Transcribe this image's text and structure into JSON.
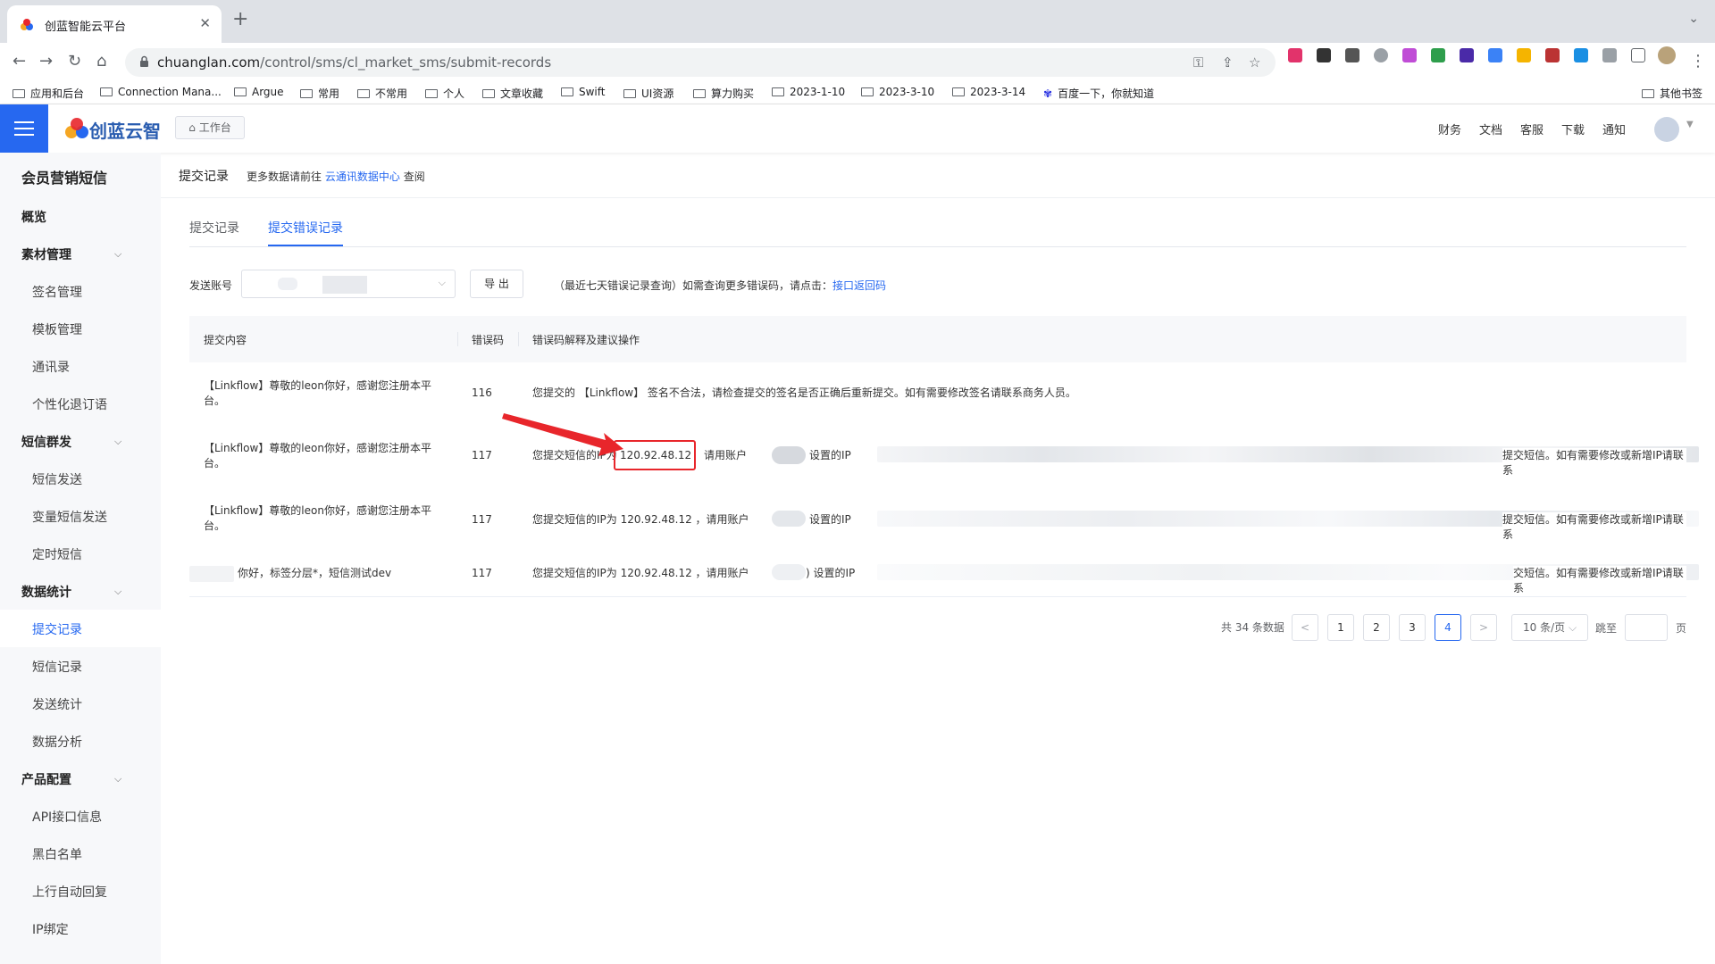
{
  "browser": {
    "tab_title": "创蓝智能云平台",
    "tab_close": "✕",
    "new_tab": "+",
    "tab_menu": "⌄",
    "url_host": "chuanglan.com",
    "url_path": "/control/sms/cl_market_sms/submit-records",
    "bookmarks": [
      "应用和后台",
      "Connection Mana...",
      "Argue",
      "常用",
      "不常用",
      "个人",
      "文章收藏",
      "Swift",
      "UI资源",
      "算力购买",
      "2023-1-10",
      "2023-3-10",
      "2023-3-14",
      "百度一下，你就知道"
    ],
    "other_bookmarks": "其他书签"
  },
  "header": {
    "logo_text": "创蓝云智",
    "workbench": "工作台",
    "nav": [
      "财务",
      "文档",
      "客服",
      "下载",
      "通知"
    ]
  },
  "sidebar": {
    "title": "会员营销短信",
    "overview": "概览",
    "groups": [
      {
        "label": "素材管理",
        "items": [
          "签名管理",
          "模板管理",
          "通讯录",
          "个性化退订语"
        ]
      },
      {
        "label": "短信群发",
        "items": [
          "短信发送",
          "变量短信发送",
          "定时短信"
        ]
      },
      {
        "label": "数据统计",
        "items": [
          "提交记录",
          "短信记录",
          "发送统计",
          "数据分析"
        ]
      },
      {
        "label": "产品配置",
        "items": [
          "API接口信息",
          "黑白名单",
          "上行自动回复",
          "IP绑定"
        ]
      }
    ],
    "active_item": "提交记录"
  },
  "main": {
    "crumb_title": "提交记录",
    "crumb_prefix": "更多数据请前往",
    "crumb_link": "云通讯数据中心",
    "crumb_suffix": "查阅",
    "tabs": [
      {
        "label": "提交记录",
        "active": false
      },
      {
        "label": "提交错误记录",
        "active": true
      }
    ],
    "filter": {
      "account_label": "发送账号",
      "export_label": "导 出",
      "hint": "（最近七天错误记录查询）如需查询更多错误码，请点击：",
      "hint_link": "接口返回码"
    },
    "table": {
      "columns": [
        "提交内容",
        "错误码",
        "错误码解释及建议操作"
      ],
      "rows": [
        {
          "content": "【Linkflow】尊敬的leon你好，感谢您注册本平台。",
          "code": "116",
          "explain": "您提交的 【Linkflow】 签名不合法，请检查提交的签名是否正确后重新提交。如有需要修改签名请联系商务人员。"
        },
        {
          "content": "【Linkflow】尊敬的leon你好，感谢您注册本平台。",
          "code": "117",
          "explain_prefix": "您提交短信的IP为",
          "ip": "120.92.48.12",
          "explain_mid": "请用账户",
          "explain_mid2": "设置的IP",
          "explain_tail": "提交短信。如有需要修改或新增IP请联系"
        },
        {
          "content": "【Linkflow】尊敬的leon你好，感谢您注册本平台。",
          "code": "117",
          "explain_prefix": "您提交短信的IP为 120.92.48.12 ，请用账户",
          "explain_mid2": "设置的IP",
          "explain_tail": "提交短信。如有需要修改或新增IP请联系"
        },
        {
          "content": "你好，标签分层*，短信测试dev",
          "code": "117",
          "explain_prefix": "您提交短信的IP为 120.92.48.12 ，请用账户",
          "explain_mid2": ") 设置的IP",
          "explain_tail": "交短信。如有需要修改或新增IP请联系"
        }
      ]
    },
    "pagination": {
      "total": "共 34 条数据",
      "pages": [
        "1",
        "2",
        "3",
        "4"
      ],
      "current": "4",
      "prev": "<",
      "next": ">",
      "page_size": "10 条/页",
      "jump_label": "跳至",
      "jump_suffix": "页"
    }
  },
  "colors": {
    "primary": "#2668f0",
    "annotation_red": "#e8262b"
  }
}
